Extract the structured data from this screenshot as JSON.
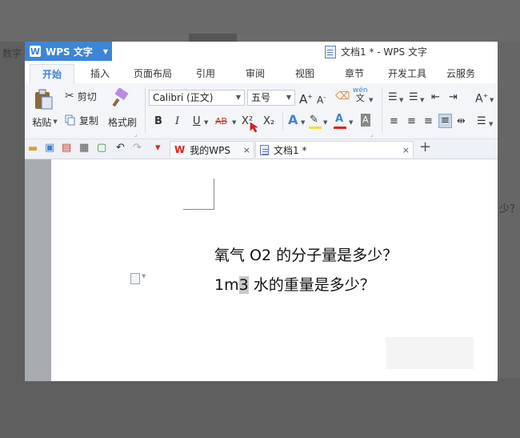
{
  "background": {
    "left_text": "数字",
    "right_text": "少？"
  },
  "app": {
    "name": "WPS 文字",
    "doc_title": "文档1 * - WPS 文字"
  },
  "tabs": [
    {
      "label": "开始",
      "active": true
    },
    {
      "label": "插入"
    },
    {
      "label": "页面布局"
    },
    {
      "label": "引用"
    },
    {
      "label": "审阅"
    },
    {
      "label": "视图"
    },
    {
      "label": "章节"
    },
    {
      "label": "开发工具"
    },
    {
      "label": "云服务"
    }
  ],
  "ribbon": {
    "paste_label": "粘贴",
    "cut_label": "剪切",
    "copy_label": "复制",
    "format_painter_label": "格式刷",
    "font_name": "Calibri (正文)",
    "font_size": "五号",
    "bold": "B",
    "italic": "I",
    "underline": "U",
    "strikethrough": "AB",
    "superscript": "X²",
    "subscript": "X₂",
    "phonetic": "wén",
    "grow_font": "A",
    "shrink_font": "A",
    "text_effect": "A",
    "font_color": "A",
    "char_shading": "A"
  },
  "doc_tabs": [
    {
      "label": "我的WPS",
      "close": "×"
    },
    {
      "label": "文档1 *",
      "close": "×",
      "active": true
    }
  ],
  "new_tab": "+",
  "document": {
    "line1": "氧气 O2 的分子量是多少？",
    "line2_prefix": "1m",
    "line2_highlight": "3",
    "line2_suffix": " 水的重量是多少？"
  },
  "colors": {
    "accent": "#3d85d6",
    "font_color_bar": "#e02020",
    "highlight_bar": "#f0e040"
  }
}
